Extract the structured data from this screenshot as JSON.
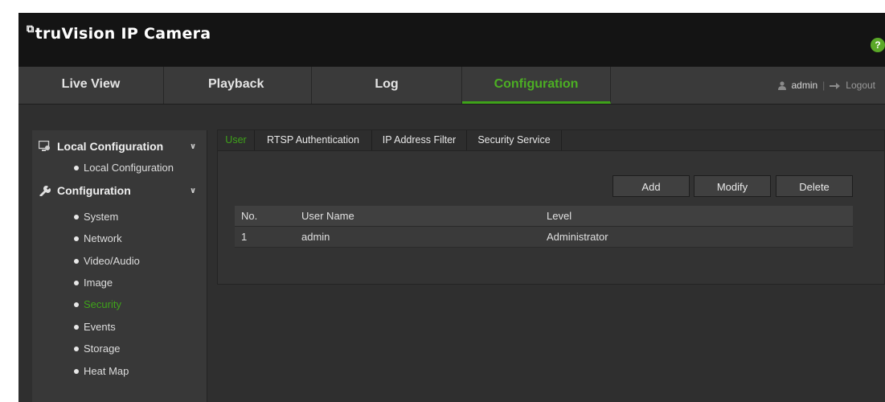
{
  "brand": {
    "title": "truVision IP Camera",
    "help_label": "?"
  },
  "nav": {
    "tabs": [
      "Live View",
      "Playback",
      "Log",
      "Configuration"
    ],
    "active": "Configuration",
    "user": "admin",
    "logout": "Logout"
  },
  "sidebar": {
    "local_header": "Local Configuration",
    "local_items": [
      "Local Configuration"
    ],
    "config_header": "Configuration",
    "config_items": [
      "System",
      "Network",
      "Video/Audio",
      "Image",
      "Security",
      "Events",
      "Storage",
      "Heat Map"
    ],
    "active_item": "Security"
  },
  "subtabs": {
    "items": [
      "User",
      "RTSP Authentication",
      "IP Address Filter",
      "Security Service"
    ],
    "active": "User"
  },
  "actions": {
    "add": "Add",
    "modify": "Modify",
    "delete": "Delete"
  },
  "user_table": {
    "columns": [
      "No.",
      "User Name",
      "Level"
    ],
    "rows": [
      {
        "no": "1",
        "name": "admin",
        "level": "Administrator"
      }
    ]
  },
  "colors": {
    "accent": "#3fa31a",
    "help_badge": "#5aa828",
    "topbar": "#141414",
    "panel": "#2f2f2f"
  },
  "icons": {
    "local_config": "monitor-config-icon",
    "configuration": "wrench-icon",
    "user": "user-icon",
    "logout": "logout-arrow-icon",
    "help": "help-icon"
  }
}
